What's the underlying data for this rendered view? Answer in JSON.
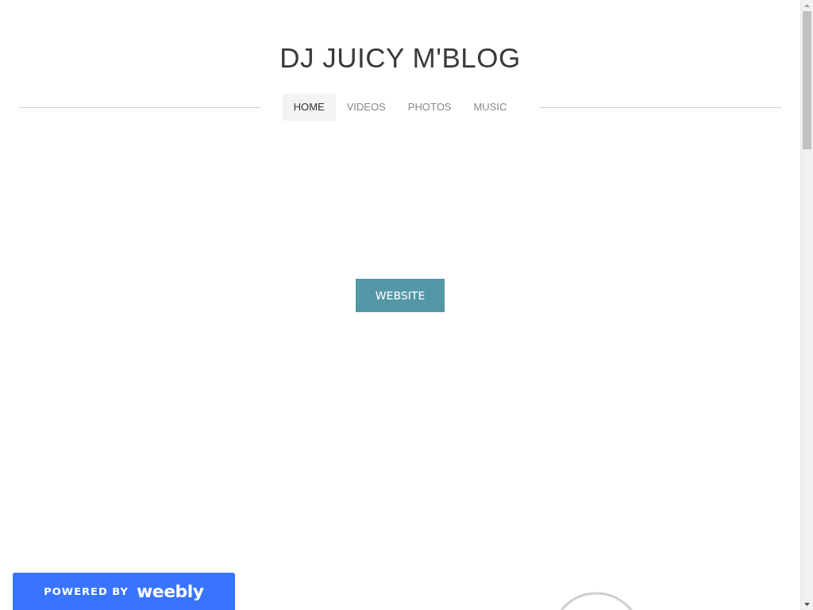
{
  "site_title": "DJ JUICY M'BLOG",
  "nav": [
    {
      "label": "HOME",
      "selected": true
    },
    {
      "label": "VIDEOS",
      "selected": false
    },
    {
      "label": "PHOTOS",
      "selected": false
    },
    {
      "label": "MUSIC",
      "selected": false
    }
  ],
  "website_button": {
    "label": "WEBSITE"
  },
  "badge": {
    "prefix": "POWERED BY",
    "brand": "weebly"
  }
}
